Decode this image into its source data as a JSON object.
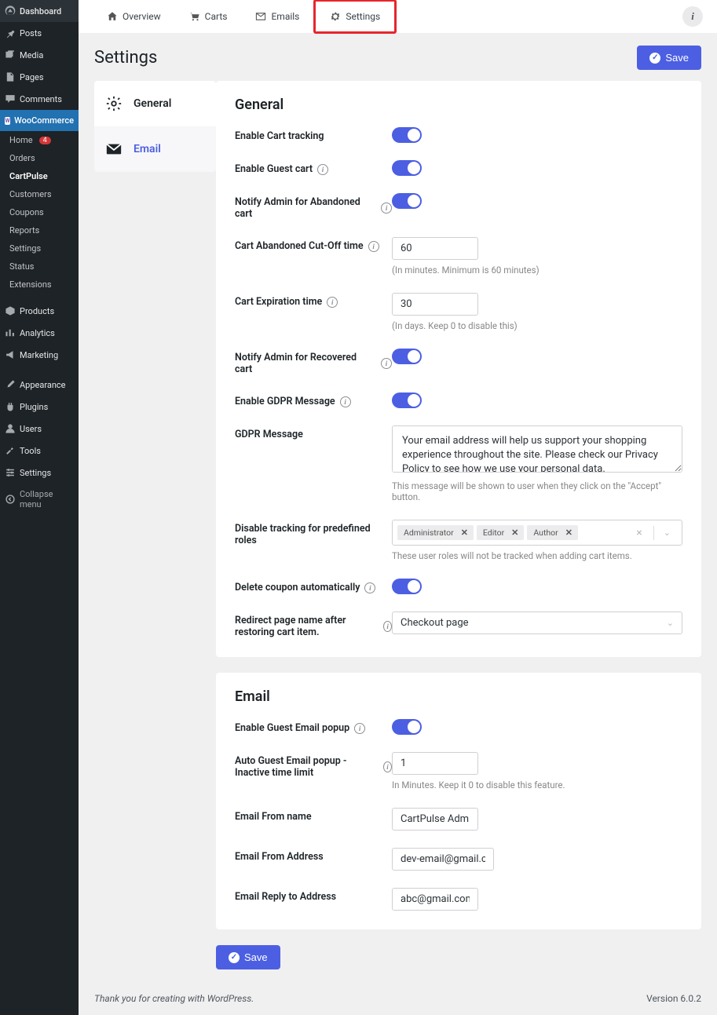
{
  "sidebar": {
    "dashboard": "Dashboard",
    "posts": "Posts",
    "media": "Media",
    "pages": "Pages",
    "comments": "Comments",
    "woocommerce": "WooCommerce",
    "submenu": {
      "home": "Home",
      "home_badge": "4",
      "orders": "Orders",
      "cartpulse": "CartPulse",
      "customers": "Customers",
      "coupons": "Coupons",
      "reports": "Reports",
      "settings": "Settings",
      "status": "Status",
      "extensions": "Extensions"
    },
    "products": "Products",
    "analytics": "Analytics",
    "marketing": "Marketing",
    "appearance": "Appearance",
    "plugins": "Plugins",
    "users": "Users",
    "tools": "Tools",
    "settings": "Settings",
    "collapse": "Collapse menu"
  },
  "top_tabs": {
    "overview": "Overview",
    "carts": "Carts",
    "emails": "Emails",
    "settings": "Settings"
  },
  "page_title": "Settings",
  "save": "Save",
  "side_tabs": {
    "general": "General",
    "email": "Email"
  },
  "general": {
    "title": "General",
    "enable_tracking": "Enable Cart tracking",
    "enable_guest": "Enable Guest cart",
    "notify_abandoned": "Notify Admin for Abandoned cart",
    "cutoff_label": "Cart Abandoned Cut-Off time",
    "cutoff_value": "60",
    "cutoff_hint": "(In minutes. Minimum is 60 minutes)",
    "expiration_label": "Cart Expiration time",
    "expiration_value": "30",
    "expiration_hint": "(In days. Keep 0 to disable this)",
    "notify_recovered": "Notify Admin for Recovered cart",
    "enable_gdpr": "Enable GDPR Message",
    "gdpr_label": "GDPR Message",
    "gdpr_text": "Your email address will help us support your shopping experience throughout the site. Please check our Privacy Policy to see how we use your personal data.",
    "gdpr_hint": "This message will be shown to user when they click on the \"Accept\" button.",
    "disable_roles_label": "Disable tracking for predefined roles",
    "roles": [
      "Administrator",
      "Editor",
      "Author"
    ],
    "roles_hint": "These user roles will not be tracked when adding cart items.",
    "delete_coupon": "Delete coupon automatically",
    "redirect_label": "Redirect page name after restoring cart item.",
    "redirect_value": "Checkout page"
  },
  "email": {
    "title": "Email",
    "enable_popup": "Enable Guest Email popup",
    "inactive_label": "Auto Guest Email popup - Inactive time limit",
    "inactive_value": "1",
    "inactive_hint": "In Minutes. Keep it 0 to disable this feature.",
    "from_name_label": "Email From name",
    "from_name_value": "CartPulse Admin",
    "from_addr_label": "Email From Address",
    "from_addr_value": "dev-email@gmail.com",
    "reply_label": "Email Reply to Address",
    "reply_value": "abc@gmail.com"
  },
  "footer": {
    "left": "Thank you for creating with WordPress.",
    "right": "Version 6.0.2"
  }
}
